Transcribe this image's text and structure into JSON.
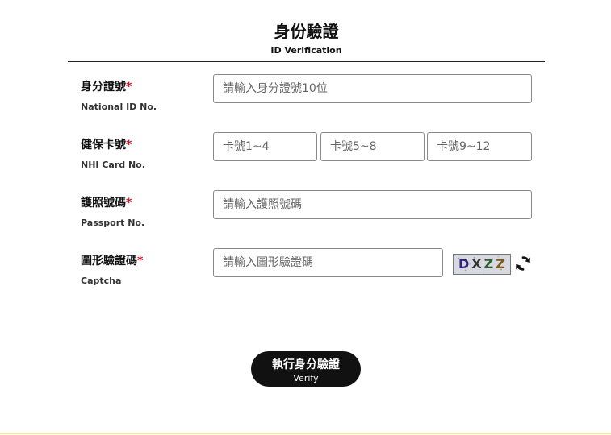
{
  "header": {
    "title_zh": "身份驗證",
    "title_en": "ID Verification"
  },
  "form": {
    "required_mark": "*",
    "national_id": {
      "label_zh": "身分證號",
      "label_en": "National ID No.",
      "placeholder": "請輸入身分證號10位",
      "value": ""
    },
    "nhi_card": {
      "label_zh": "健保卡號",
      "label_en": "NHI Card No.",
      "part1_placeholder": "卡號1~4",
      "part2_placeholder": "卡號5~8",
      "part3_placeholder": "卡號9~12"
    },
    "passport": {
      "label_zh": "護照號碼",
      "label_en": "Passport No.",
      "placeholder": "請輸入護照號碼",
      "value": ""
    },
    "captcha": {
      "label_zh": "圖形驗證碼",
      "label_en": "Captcha",
      "placeholder": "請輸入圖形驗證碼",
      "image_chars": [
        "D",
        "X",
        "Z",
        "Z"
      ],
      "refresh_icon": "refresh-icon"
    }
  },
  "verify_button": {
    "label_zh": "執行身分驗證",
    "label_en": "Verify"
  },
  "colors": {
    "required": "#d0021b",
    "button_bg": "#111111",
    "button_text": "#ffffff",
    "input_border": "#8a8a8a",
    "bottom_accent": "#f3e6a0"
  }
}
